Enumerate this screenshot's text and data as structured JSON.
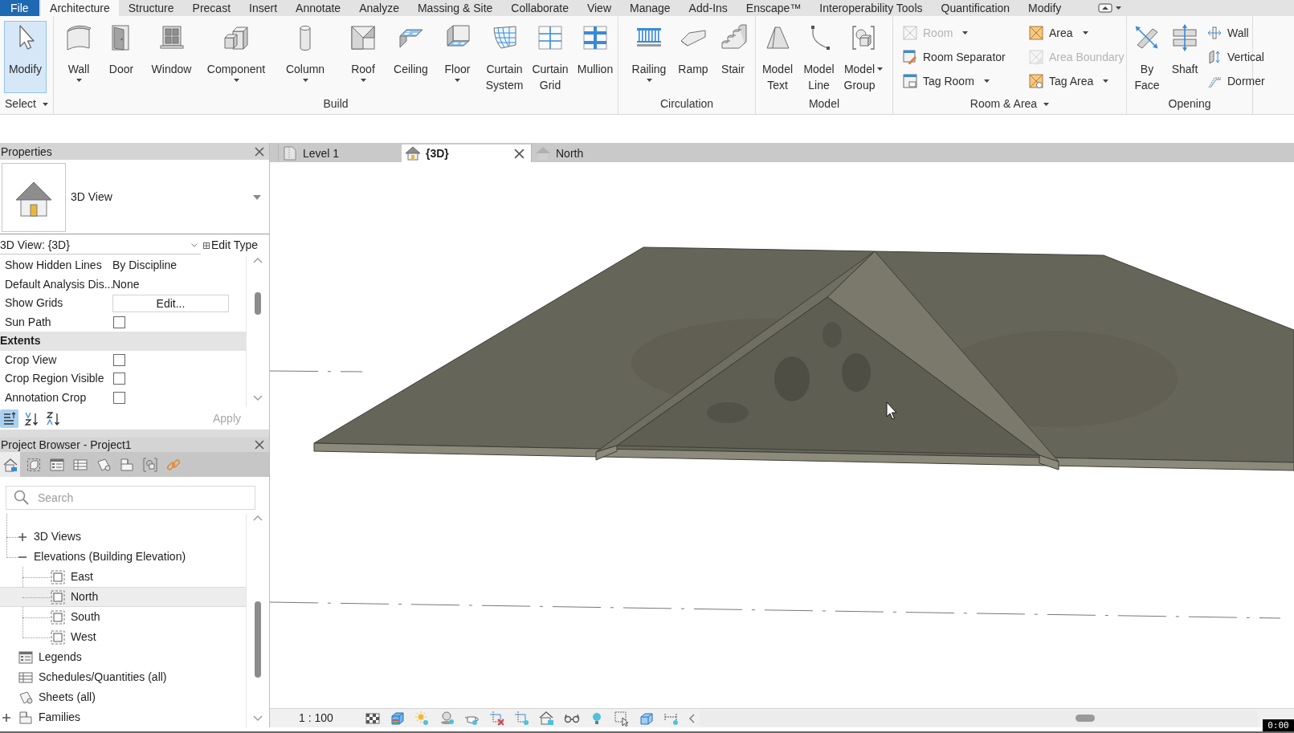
{
  "ribbon_tabs": [
    {
      "label": "File",
      "kind": "file",
      "selected": false
    },
    {
      "label": "Architecture",
      "kind": "tab",
      "selected": true
    },
    {
      "label": "Structure",
      "kind": "tab",
      "selected": false
    },
    {
      "label": "Precast",
      "kind": "tab",
      "selected": false
    },
    {
      "label": "Insert",
      "kind": "tab",
      "selected": false
    },
    {
      "label": "Annotate",
      "kind": "tab",
      "selected": false
    },
    {
      "label": "Analyze",
      "kind": "tab",
      "selected": false
    },
    {
      "label": "Massing & Site",
      "kind": "tab",
      "selected": false
    },
    {
      "label": "Collaborate",
      "kind": "tab",
      "selected": false
    },
    {
      "label": "View",
      "kind": "tab",
      "selected": false
    },
    {
      "label": "Manage",
      "kind": "tab",
      "selected": false
    },
    {
      "label": "Add-Ins",
      "kind": "tab",
      "selected": false
    },
    {
      "label": "Enscape™",
      "kind": "tab",
      "selected": false
    },
    {
      "label": "Interoperability Tools",
      "kind": "tab",
      "selected": false
    },
    {
      "label": "Quantification",
      "kind": "tab",
      "selected": false
    },
    {
      "label": "Modify",
      "kind": "tab",
      "selected": false
    }
  ],
  "ribbon_groups": [
    {
      "label": "Select",
      "dropdown": true,
      "buttons": [
        {
          "kind": "modify",
          "label": "Modify",
          "active": true,
          "disabled": false,
          "dropdown": false
        }
      ]
    },
    {
      "label": "Build",
      "dropdown": false,
      "buttons": [
        {
          "kind": "wall",
          "label": "Wall",
          "active": false,
          "disabled": false,
          "dropdown": true
        },
        {
          "kind": "door",
          "label": "Door",
          "active": false,
          "disabled": false,
          "dropdown": false
        },
        {
          "kind": "window",
          "label": "Window",
          "active": false,
          "disabled": false,
          "dropdown": false
        },
        {
          "kind": "component",
          "label": "Component",
          "active": false,
          "disabled": false,
          "dropdown": true
        },
        {
          "kind": "column",
          "label": "Column",
          "active": false,
          "disabled": false,
          "dropdown": true
        },
        {
          "kind": "roof",
          "label": "Roof",
          "active": false,
          "disabled": false,
          "dropdown": true
        },
        {
          "kind": "ceiling",
          "label": "Ceiling",
          "active": false,
          "disabled": false,
          "dropdown": false
        },
        {
          "kind": "floor",
          "label": "Floor",
          "active": false,
          "disabled": false,
          "dropdown": true
        },
        {
          "kind": "curtain_system",
          "label": "Curtain System",
          "active": false,
          "disabled": false,
          "dropdown": false
        },
        {
          "kind": "curtain_grid",
          "label": "Curtain Grid",
          "active": false,
          "disabled": false,
          "dropdown": false
        },
        {
          "kind": "mullion",
          "label": "Mullion",
          "active": false,
          "disabled": false,
          "dropdown": false
        }
      ]
    },
    {
      "label": "Circulation",
      "dropdown": false,
      "buttons": [
        {
          "kind": "railing",
          "label": "Railing",
          "active": false,
          "disabled": false,
          "dropdown": true
        },
        {
          "kind": "ramp",
          "label": "Ramp",
          "active": false,
          "disabled": false,
          "dropdown": false
        },
        {
          "kind": "stair",
          "label": "Stair",
          "active": false,
          "disabled": false,
          "dropdown": false
        }
      ]
    },
    {
      "label": "Model",
      "dropdown": false,
      "buttons": [
        {
          "kind": "model_text",
          "label": "Model Text",
          "active": false,
          "disabled": false,
          "dropdown": false
        },
        {
          "kind": "model_line",
          "label": "Model Line",
          "active": false,
          "disabled": false,
          "dropdown": false
        },
        {
          "kind": "model_group",
          "label": "Model Group",
          "active": false,
          "disabled": false,
          "dropdown": true
        }
      ]
    },
    {
      "label": "Room & Area",
      "dropdown": true,
      "small_buttons": [
        {
          "kind": "room",
          "label": "Room",
          "active": false,
          "disabled": true,
          "dropdown": true
        },
        {
          "kind": "room_separator",
          "label": "Room Separator",
          "active": false,
          "disabled": false,
          "dropdown": false
        },
        {
          "kind": "tag_room",
          "label": "Tag Room",
          "active": false,
          "disabled": false,
          "dropdown": true
        },
        {
          "kind": "area",
          "label": "Area",
          "active": false,
          "disabled": false,
          "dropdown": true
        },
        {
          "kind": "area_boundary",
          "label": "Area Boundary",
          "active": false,
          "disabled": true,
          "dropdown": false
        },
        {
          "kind": "tag_area",
          "label": "Tag Area",
          "active": false,
          "disabled": false,
          "dropdown": true
        }
      ]
    },
    {
      "label": "Opening",
      "dropdown": false,
      "buttons": [
        {
          "kind": "by_face",
          "label": "By Face",
          "active": false,
          "disabled": false,
          "dropdown": false
        },
        {
          "kind": "shaft",
          "label": "Shaft",
          "active": false,
          "disabled": false,
          "dropdown": false
        }
      ],
      "small_buttons": [
        {
          "kind": "wall_opening",
          "label": "Wall",
          "active": false,
          "disabled": false,
          "dropdown": false
        },
        {
          "kind": "vertical",
          "label": "Vertical",
          "active": false,
          "disabled": false,
          "dropdown": false
        },
        {
          "kind": "dormer",
          "label": "Dormer",
          "active": false,
          "disabled": false,
          "dropdown": false
        }
      ]
    }
  ],
  "properties": {
    "title": "Properties",
    "type_name": "3D View",
    "instance": "3D View: {3D}",
    "edit_type": "Edit Type",
    "rows": [
      {
        "kind": "value",
        "name": "Show Hidden Lines",
        "value": "By Discipline"
      },
      {
        "kind": "value",
        "name": "Default Analysis Dis...",
        "value": "None"
      },
      {
        "kind": "button",
        "name": "Show Grids",
        "value": "Edit..."
      },
      {
        "kind": "checkbox",
        "name": "Sun Path",
        "checked": false
      },
      {
        "kind": "group",
        "name": "Extents"
      },
      {
        "kind": "checkbox",
        "name": "Crop View",
        "checked": false
      },
      {
        "kind": "checkbox",
        "name": "Crop Region Visible",
        "checked": false
      },
      {
        "kind": "checkbox",
        "name": "Annotation Crop",
        "checked": false
      }
    ],
    "sort_buttons": [
      {
        "kind": "categorized",
        "selected": true
      },
      {
        "kind": "ascending",
        "selected": false
      },
      {
        "kind": "descending",
        "selected": false
      }
    ],
    "apply": {
      "label": "Apply",
      "disabled": true
    }
  },
  "project_browser": {
    "title": "Project Browser - Project1",
    "tabs": [
      {
        "kind": "views",
        "selected": true
      },
      {
        "kind": "model",
        "selected": false
      },
      {
        "kind": "legends",
        "selected": false
      },
      {
        "kind": "schedules",
        "selected": false
      },
      {
        "kind": "sheets",
        "selected": false
      },
      {
        "kind": "families",
        "selected": false
      },
      {
        "kind": "groups",
        "selected": false
      },
      {
        "kind": "links",
        "selected": false
      }
    ],
    "search": {
      "placeholder": "Search"
    },
    "tree": [
      {
        "children": [
          {
            "label": "3D Views",
            "expanded": false,
            "selected": false
          },
          {
            "label": "Elevations (Building Elevation)",
            "expanded": true,
            "selected": false,
            "children": [
              {
                "label": "East",
                "kind": "elevation",
                "selected": false
              },
              {
                "label": "North",
                "kind": "elevation",
                "selected": true
              },
              {
                "label": "South",
                "kind": "elevation",
                "selected": false
              },
              {
                "label": "West",
                "kind": "elevation",
                "selected": false
              }
            ]
          }
        ]
      },
      {
        "label": "Legends",
        "kind": "legend",
        "selected": false
      },
      {
        "label": "Schedules/Quantities (all)",
        "kind": "schedule",
        "selected": false
      },
      {
        "label": "Sheets (all)",
        "kind": "sheet",
        "selected": false
      },
      {
        "label": "Families",
        "kind": "family",
        "expanded": false,
        "selected": false
      }
    ]
  },
  "view_tabs": [
    {
      "label": "Level 1",
      "kind": "plan",
      "selected": false
    },
    {
      "label": "{3D}",
      "kind": "perspective",
      "selected": true
    },
    {
      "label": "North",
      "kind": "elevation",
      "selected": false
    }
  ],
  "view_controls": {
    "scale": "1 : 100"
  },
  "timestamp": "0:00"
}
